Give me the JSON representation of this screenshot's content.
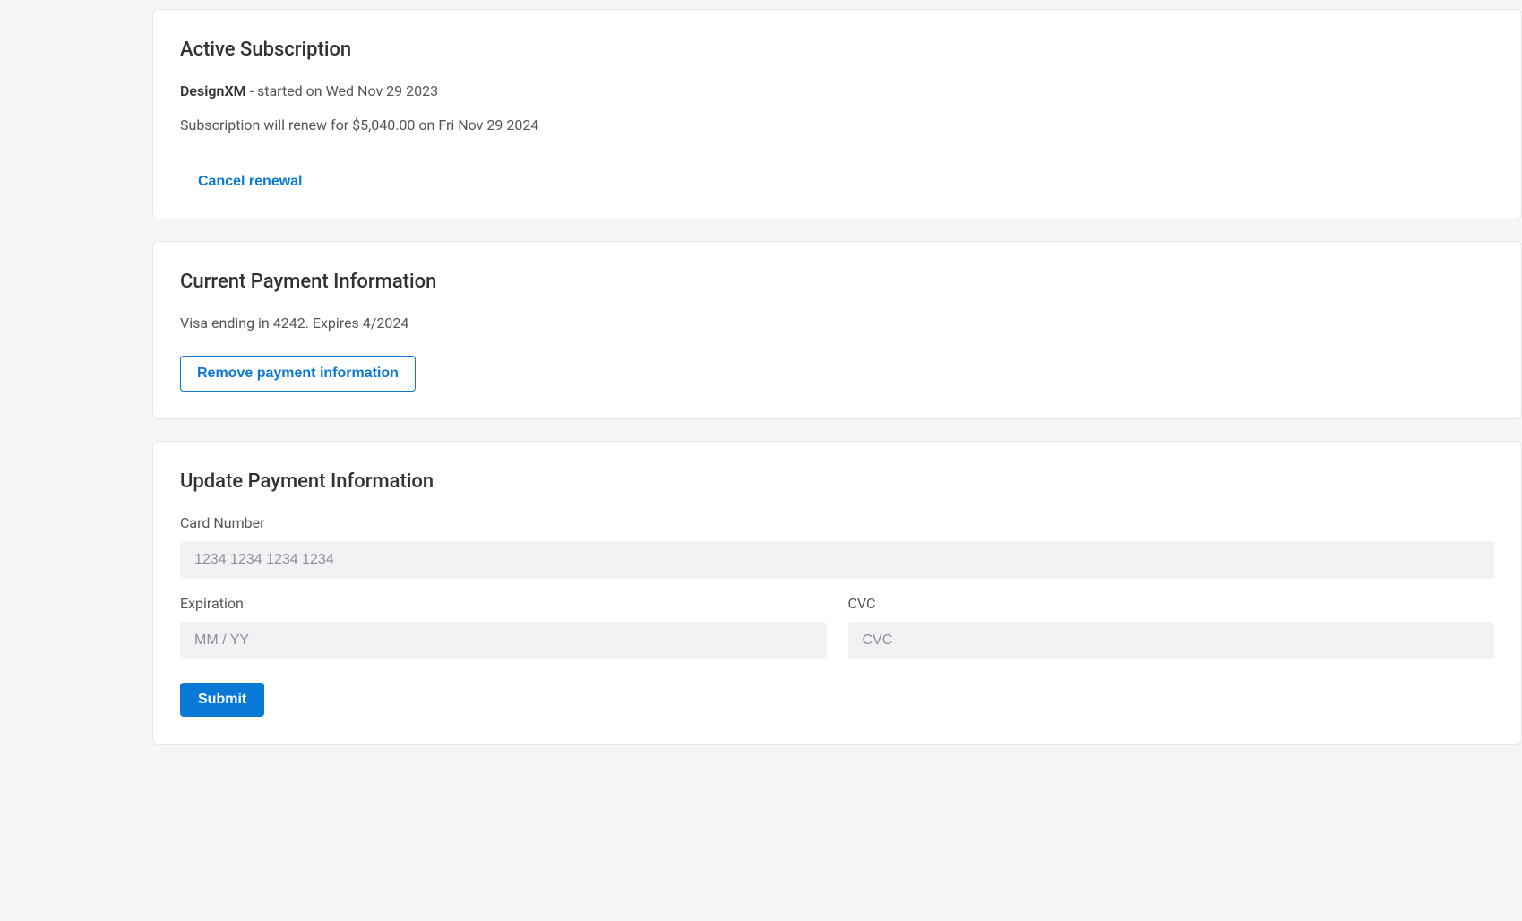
{
  "subscription": {
    "heading": "Active Subscription",
    "product_name": "DesignXM",
    "started_text": " - started on Wed Nov 29 2023",
    "renewal_text": "Subscription will renew for $5,040.00 on Fri Nov 29 2024",
    "cancel_label": "Cancel renewal"
  },
  "current_payment": {
    "heading": "Current Payment Information",
    "summary": "Visa ending in 4242. Expires 4/2024",
    "remove_label": "Remove payment information"
  },
  "update_payment": {
    "heading": "Update Payment Information",
    "card_number_label": "Card Number",
    "card_number_placeholder": "1234 1234 1234 1234",
    "expiration_label": "Expiration",
    "expiration_placeholder": "MM / YY",
    "cvc_label": "CVC",
    "cvc_placeholder": "CVC",
    "submit_label": "Submit"
  }
}
